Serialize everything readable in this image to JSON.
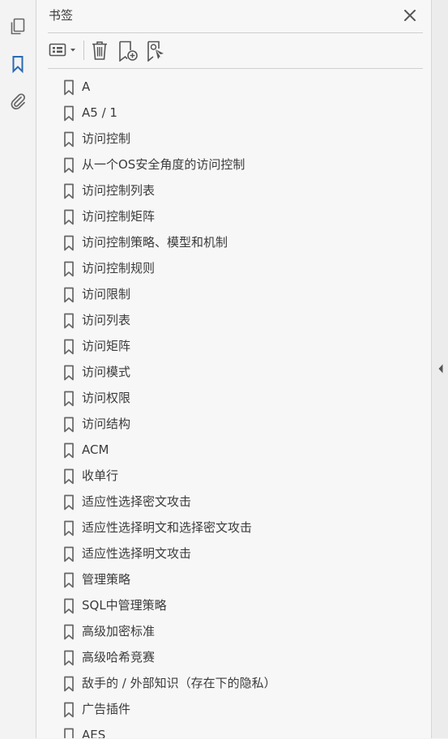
{
  "panel": {
    "title": "书签"
  },
  "colors": {
    "accent": "#2a6ab5",
    "icon": "#666666"
  },
  "rail": [
    "pages-icon",
    "bookmark-icon",
    "attachment-icon"
  ],
  "toolbar": [
    "options-menu-icon",
    "delete-icon",
    "new-bookmark-icon",
    "bookmark-from-structure-icon"
  ],
  "bookmarks": [
    "A",
    "A5 / 1",
    "访问控制",
    "从一个OS安全角度的访问控制",
    "访问控制列表",
    "访问控制矩阵",
    "访问控制策略、模型和机制",
    "访问控制规则",
    "访问限制",
    "访问列表",
    "访问矩阵",
    "访问模式",
    "访问权限",
    "访问结构",
    "ACM",
    "收单行",
    "适应性选择密文攻击",
    "适应性选择明文和选择密文攻击",
    "适应性选择明文攻击",
    "管理策略",
    "SQL中管理策略",
    "高级加密标准",
    "高级哈希竞赛",
    "敌手的 / 外部知识（存在下的隐私）",
    "广告插件",
    "AES"
  ]
}
